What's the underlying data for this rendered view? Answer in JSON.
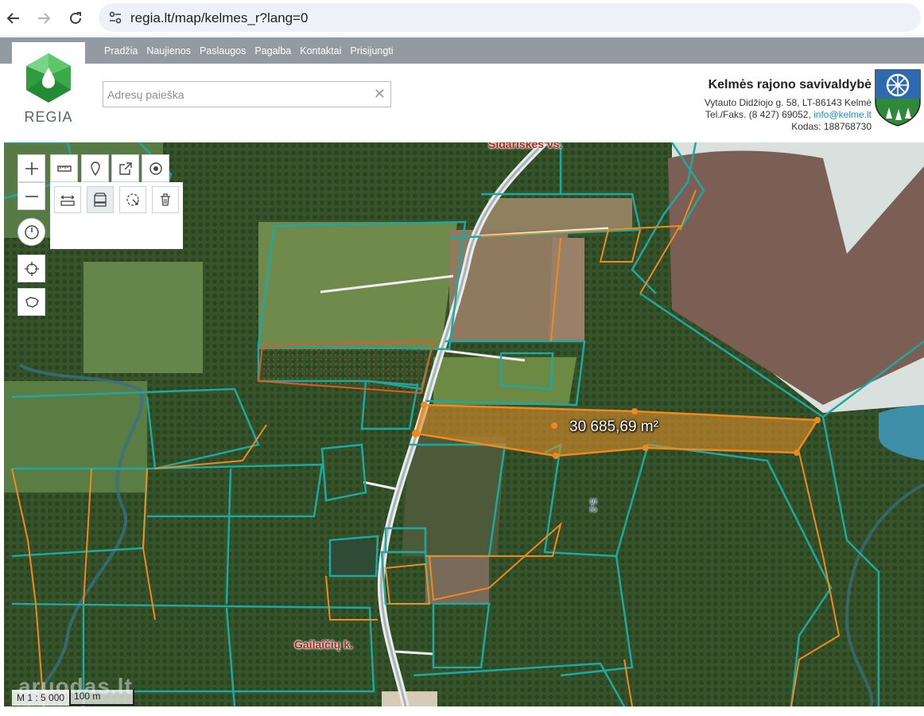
{
  "browser": {
    "url": "regia.lt/map/kelmes_r?lang=0",
    "back_icon": "arrow-left-icon",
    "forward_icon": "arrow-right-icon",
    "reload_icon": "reload-icon"
  },
  "nav": {
    "items": [
      {
        "label": "Pradžia"
      },
      {
        "label": "Naujienos"
      },
      {
        "label": "Paslaugos"
      },
      {
        "label": "Pagalba"
      },
      {
        "label": "Kontaktai"
      },
      {
        "label": "Prisijungti"
      }
    ]
  },
  "logo": {
    "text": "REGIA",
    "color": "#3bb54a"
  },
  "search": {
    "placeholder": "Adresų paieška",
    "value": "",
    "clear_label": "✕"
  },
  "municipality": {
    "name": "Kelmės rajono savivaldybė",
    "address": "Vytauto Didžiojo g. 58, LT-86143 Kelmė",
    "phone_prefix": "Tel./Faks. (8 427) 69052,",
    "email": "info@kelme.lt",
    "code": "Kodas: 188768730"
  },
  "map": {
    "measured_area": "30 685,69 m²",
    "places": [
      "Sidariškės vs.",
      "Gailaičių k."
    ],
    "stream_label": "S-2",
    "scale_ratio": "M 1 : 5 000",
    "scale_bar": "100 m",
    "watermark": "aruodas.lt",
    "colors": {
      "parcel": "#1fa7a0",
      "selection": "#f08a1c",
      "road": "#cfd6d6"
    }
  },
  "tools": {
    "zoom_in": "plus-icon",
    "zoom_out": "minus-icon",
    "ruler": "ruler-icon",
    "pin": "pin-icon",
    "export": "export-icon",
    "target": "target-icon",
    "history": "clock-icon",
    "locate": "crosshair-icon",
    "region": "region-icon",
    "measure_length": "measure-length-icon",
    "measure_area": "measure-area-icon",
    "measure_radius": "measure-radius-icon",
    "delete": "trash-icon"
  }
}
